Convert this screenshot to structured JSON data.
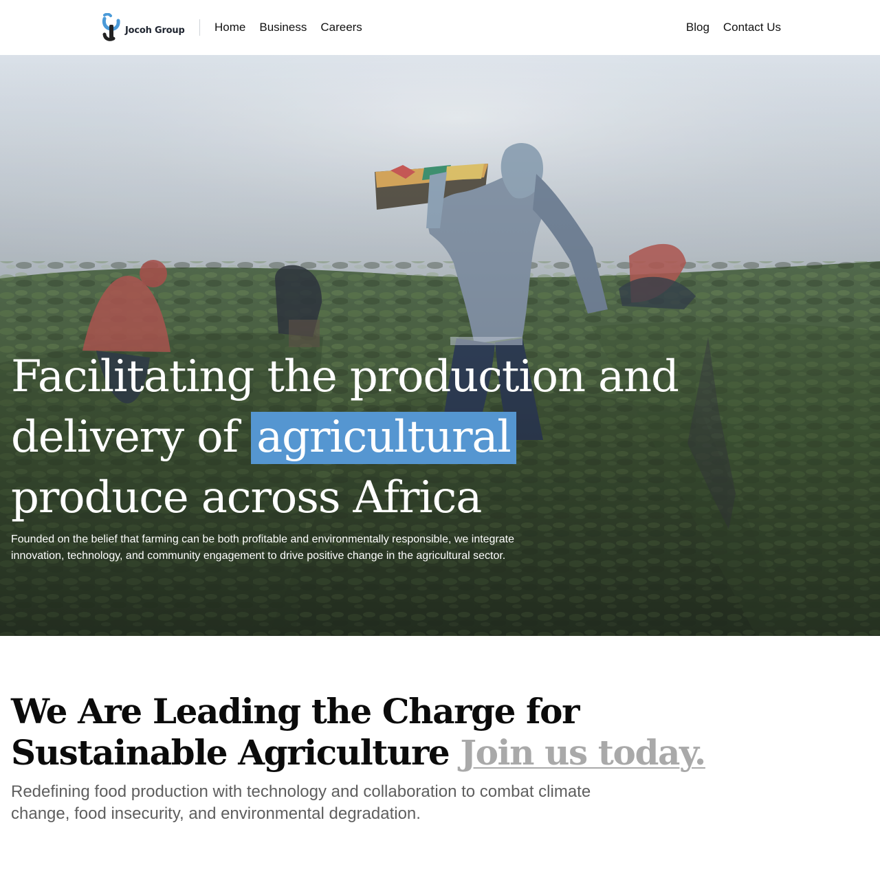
{
  "header": {
    "brand_name": "Jocoh Group",
    "logo_icon": "jocoh-logo-icon",
    "nav_left": [
      "Home",
      "Business",
      "Careers"
    ],
    "nav_right": [
      "Blog",
      "Contact Us"
    ]
  },
  "hero": {
    "title_before": "Facilitating the production and delivery of",
    "title_highlight": "agricultural",
    "title_after": "produce across Africa",
    "description": "Founded on the belief that farming can be both profitable and environmentally responsible, we integrate innovation, technology, and community engagement to drive positive change in the agricultural sector.",
    "highlight_color": "#5596d1"
  },
  "mission": {
    "title": "We Are Leading the Charge for Sustainable Agriculture",
    "cta": "Join us today.",
    "description": "Redefining food production with technology and collaboration to combat climate change, food insecurity, and environmental degradation.",
    "cta_color": "#a9a9a9"
  },
  "colors": {
    "background": "#ffffff",
    "accent_blue": "#5596d1",
    "body_text": "#111111",
    "muted_text": "#5e5e5e"
  }
}
